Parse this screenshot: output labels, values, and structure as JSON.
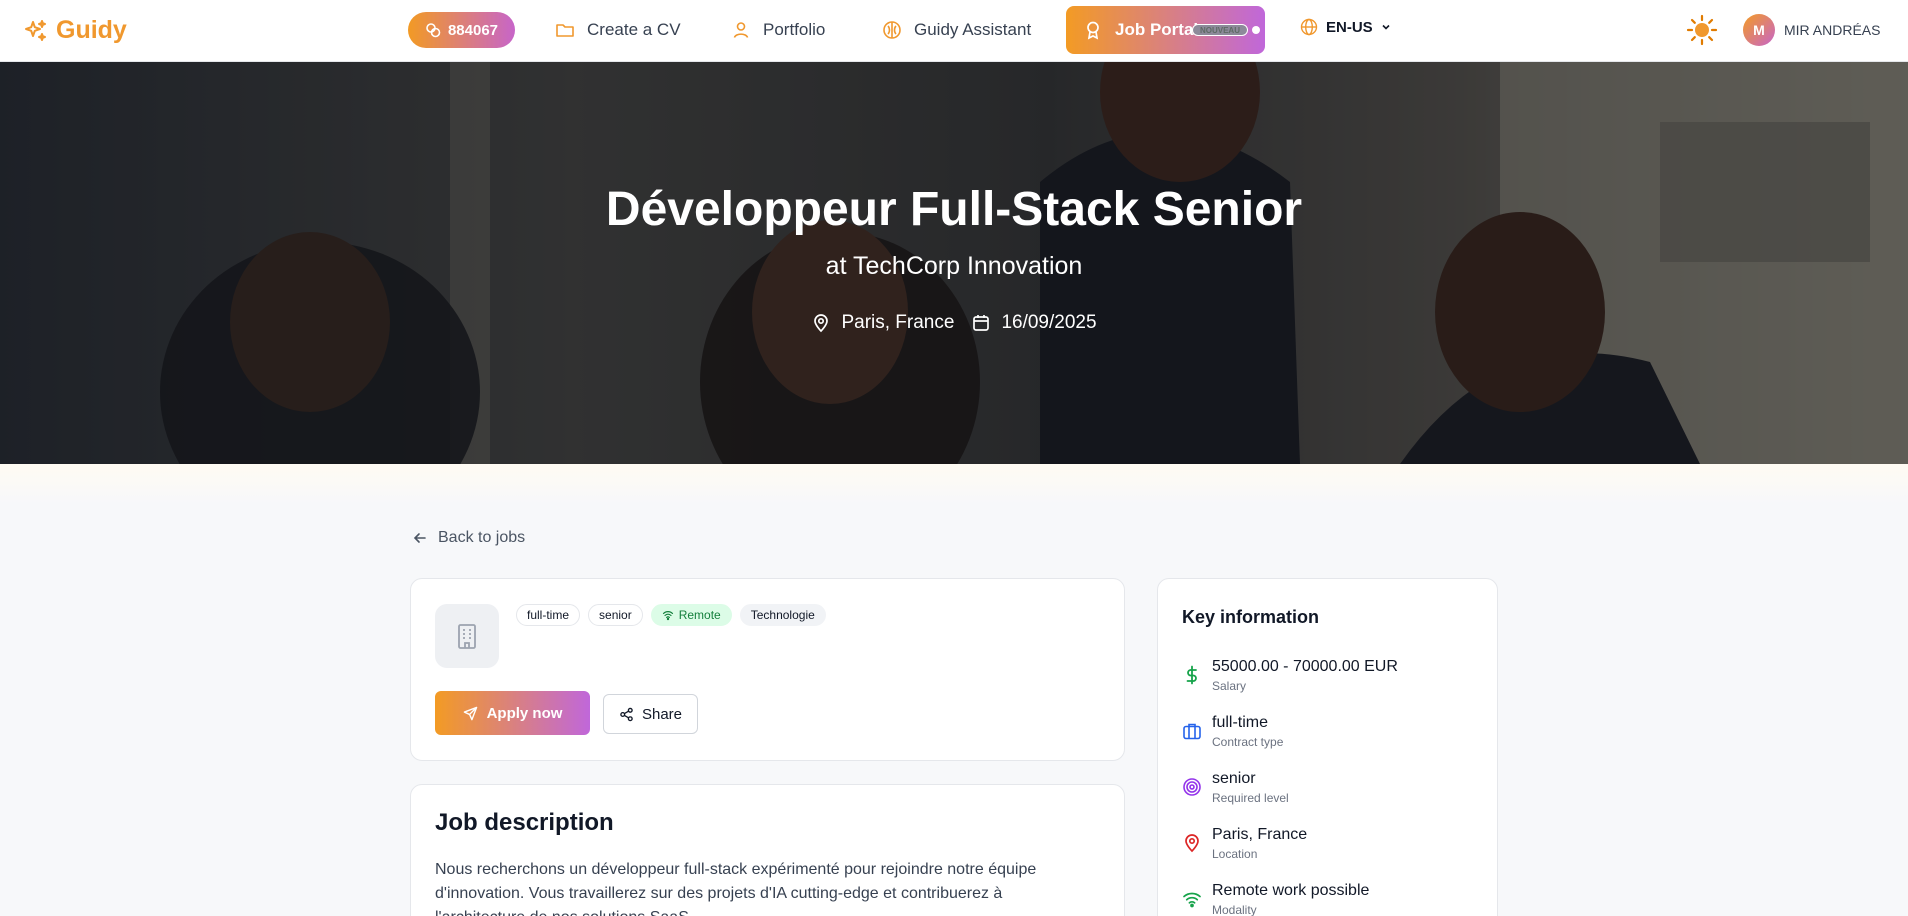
{
  "nav": {
    "brand": "Guidy",
    "credits": "884067",
    "items": [
      {
        "label": "Create a CV",
        "icon": "folder-icon"
      },
      {
        "label": "Portfolio",
        "icon": "user-icon"
      },
      {
        "label": "Guidy Assistant",
        "icon": "brain-icon"
      }
    ],
    "job_portal": {
      "label": "Job Portal",
      "badge": "NOUVEAU"
    },
    "language": "EN-US",
    "user": {
      "initial": "M",
      "name": "MIR ANDRÉAS"
    }
  },
  "hero": {
    "title": "Développeur Full-Stack Senior",
    "company": "at TechCorp Innovation",
    "location": "Paris, France",
    "date": "16/09/2025"
  },
  "back_label": "Back to jobs",
  "job": {
    "tags": [
      "full-time",
      "senior",
      "Remote",
      "Technologie"
    ],
    "apply_label": "Apply now",
    "share_label": "Share"
  },
  "description": {
    "title": "Job description",
    "text": "Nous recherchons un développeur full-stack expérimenté pour rejoindre notre équipe d'innovation. Vous travaillerez sur des projets d'IA cutting-edge et contribuerez à l'architecture de nos solutions SaaS."
  },
  "key_info": {
    "title": "Key information",
    "items": [
      {
        "value": "55000.00 - 70000.00 EUR",
        "label": "Salary",
        "icon": "dollar-icon",
        "color": "#16a34a"
      },
      {
        "value": "full-time",
        "label": "Contract type",
        "icon": "briefcase-icon",
        "color": "#2563eb"
      },
      {
        "value": "senior",
        "label": "Required level",
        "icon": "target-icon",
        "color": "#9333ea"
      },
      {
        "value": "Paris, France",
        "label": "Location",
        "icon": "map-pin-icon",
        "color": "#dc2626"
      },
      {
        "value": "Remote work possible",
        "label": "Modality",
        "icon": "wifi-icon",
        "color": "#16a34a"
      }
    ]
  },
  "colors": {
    "brand": "#f0982e",
    "gradient_start": "#f39b24",
    "gradient_end": "#c067da"
  }
}
